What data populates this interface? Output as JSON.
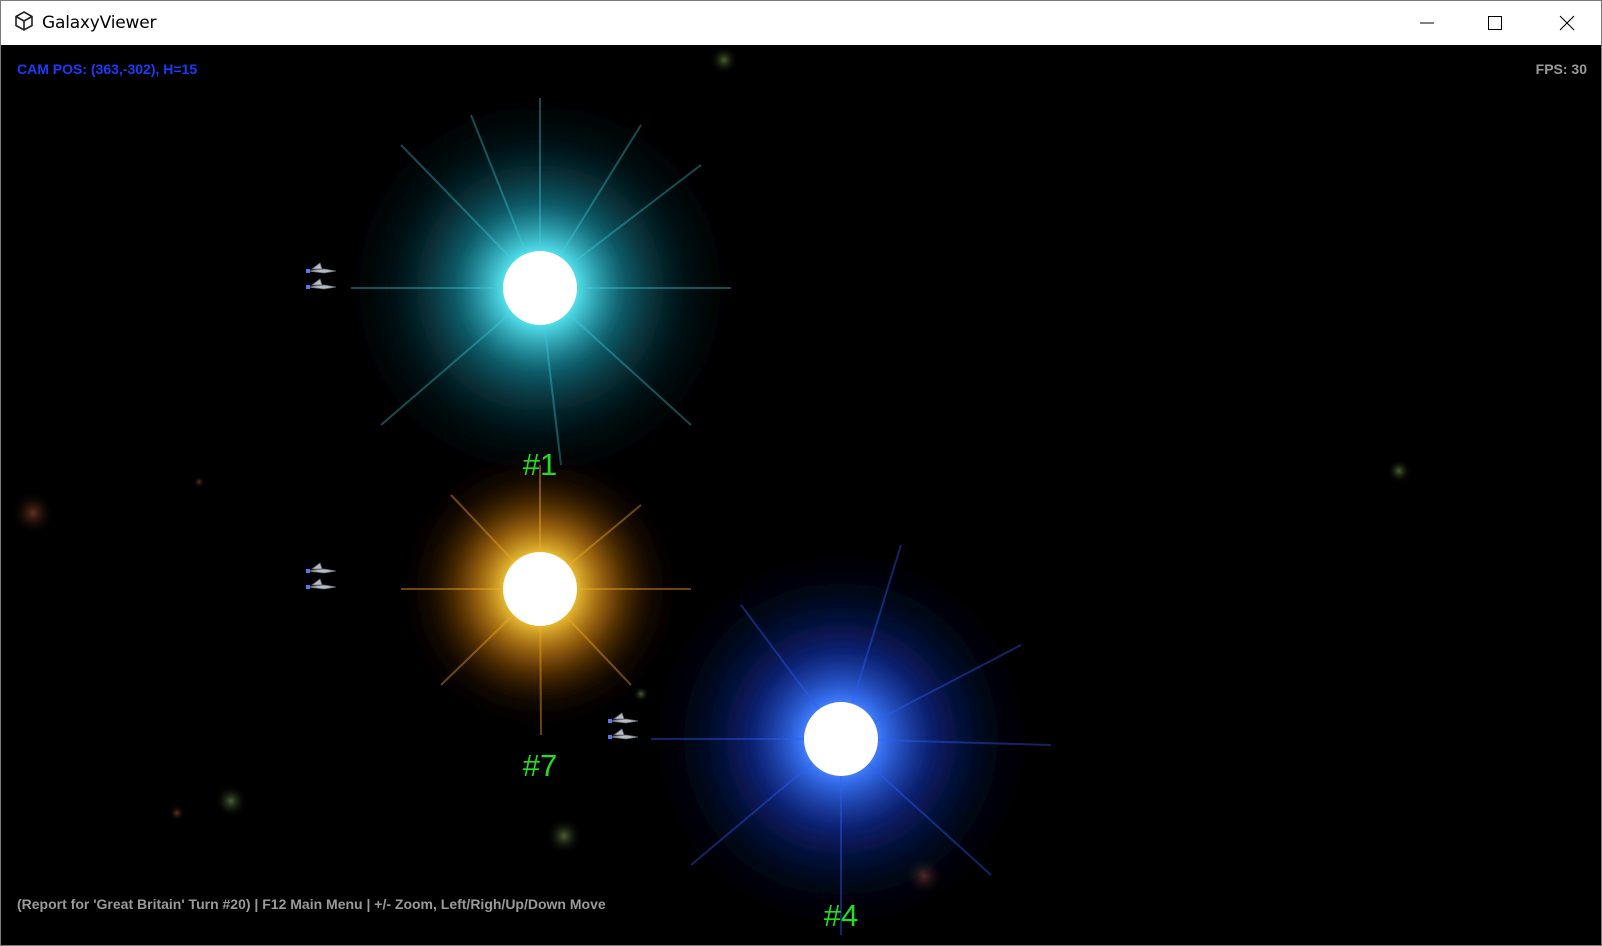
{
  "window": {
    "title": "GalaxyViewer",
    "icon": "unity-logo-icon",
    "controls": {
      "minimize": "minimize-icon",
      "maximize": "maximize-icon",
      "close": "close-icon"
    }
  },
  "hud": {
    "cam_pos": "CAM POS: (363,-302), H=15",
    "fps": "FPS: 30"
  },
  "status_bar": "(Report for 'Great Britain' Turn #20) | F12 Main Menu | +/- Zoom, Left/Righ/Up/Down Move",
  "stars": [
    {
      "label": "#1",
      "color": "cyan"
    },
    {
      "label": "#7",
      "color": "orange"
    },
    {
      "label": "#4",
      "color": "blue"
    }
  ],
  "colors": {
    "background": "#000000",
    "cam_pos_text": "#1a3cff",
    "hud_grey": "#9a9a9a",
    "star_label": "#22dd22",
    "star_cyan": "#2fd6e6",
    "star_orange": "#ffb020",
    "star_blue": "#1e5cff"
  }
}
